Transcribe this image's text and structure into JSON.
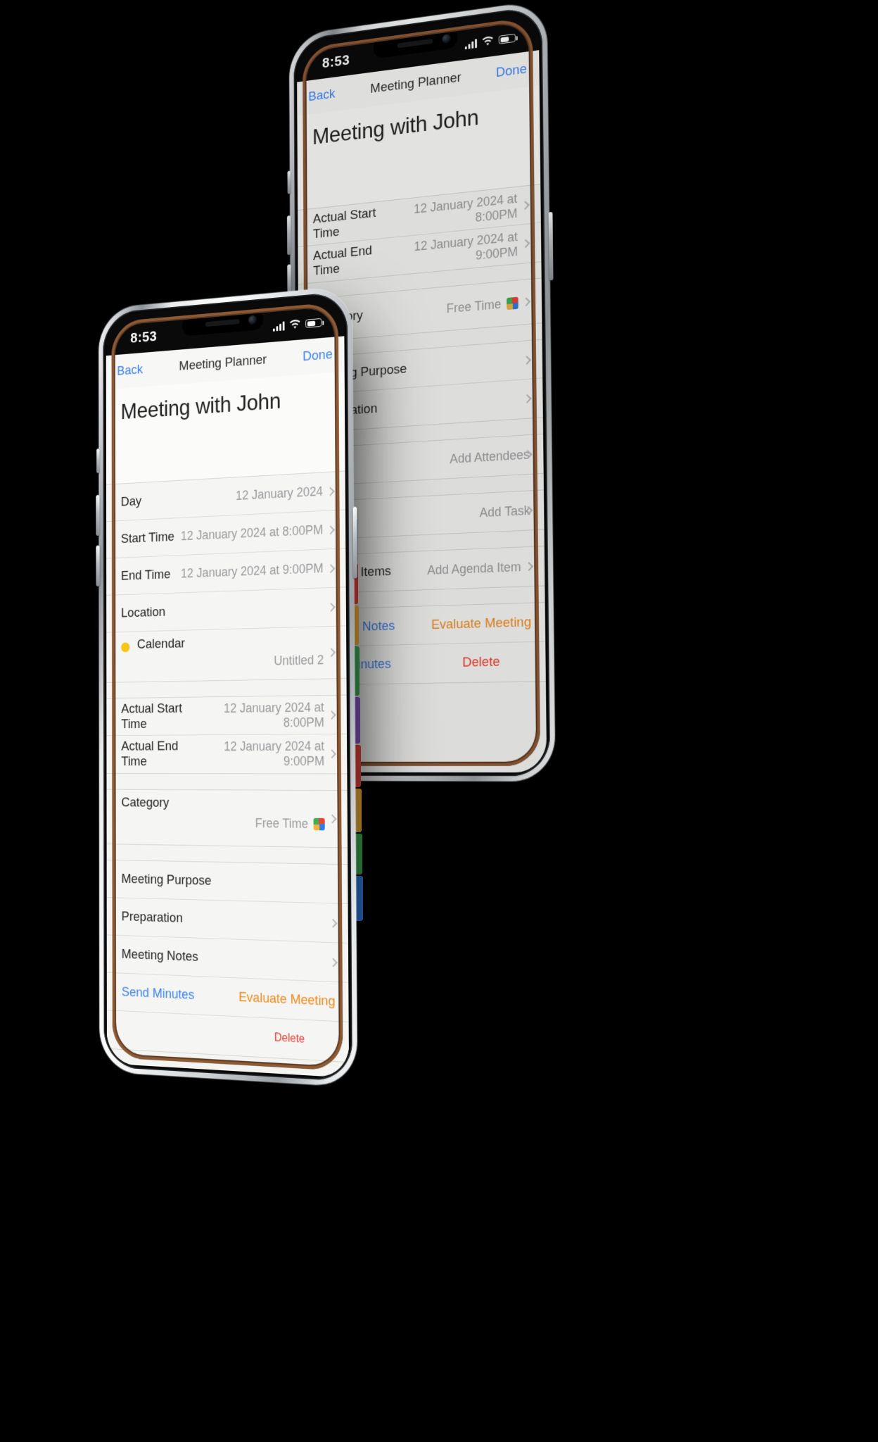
{
  "scene": {
    "background_color": "#000000",
    "device_count": 2
  },
  "status_bar": {
    "time": "8:53",
    "signal_icon": "cellular-bars-icon",
    "wifi_icon": "wifi-icon",
    "battery_icon": "battery-icon"
  },
  "navbar": {
    "back_label": "Back",
    "title": "Meeting Planner",
    "done_label": "Done"
  },
  "detail": {
    "meeting_title": "Meeting with John"
  },
  "colors": {
    "tint_blue": "#3b83f6",
    "tint_orange": "#f08b1d",
    "destructive_red": "#ef3b2d",
    "calendar_dot_yellow": "#f5c518",
    "value_gray": "#9a9a9e",
    "screen_background": "#f4f4f2"
  },
  "front_phone": {
    "groups": [
      {
        "rows": [
          {
            "label": "Day",
            "value": "12 January 2024",
            "chevron": true
          },
          {
            "label": "Start Time",
            "value": "12 January 2024 at 8:00PM",
            "chevron": true
          },
          {
            "label": "End Time",
            "value": "12 January 2024 at 9:00PM",
            "chevron": true
          },
          {
            "label": "Location",
            "value": "",
            "chevron": true
          },
          {
            "label": "Calendar",
            "value": "Untitled 2",
            "chevron": true,
            "dot": true
          }
        ]
      },
      {
        "rows": [
          {
            "label": "Actual Start Time",
            "value": "12 January 2024 at 8:00PM",
            "chevron": true
          },
          {
            "label": "Actual End Time",
            "value": "12 January 2024 at 9:00PM",
            "chevron": true
          }
        ]
      },
      {
        "rows": [
          {
            "label": "Category",
            "value": "Free Time",
            "chevron": true,
            "swatch": true
          }
        ]
      },
      {
        "rows": [
          {
            "label": "Meeting Purpose",
            "value": "",
            "chevron": false
          },
          {
            "label": "Preparation",
            "value": "",
            "chevron": true
          },
          {
            "label": "Meeting Notes",
            "value": "",
            "chevron": true,
            "link": "blue"
          }
        ]
      }
    ],
    "actions": {
      "send_minutes": "Send Minutes",
      "evaluate_meeting": "Evaluate Meeting",
      "delete": "Delete"
    }
  },
  "back_phone": {
    "rows": [
      {
        "label": "Actual Start Time",
        "value": "12 January 2024 at 8:00PM",
        "chevron": true
      },
      {
        "label": "Actual End Time",
        "value": "12 January 2024 at 9:00PM",
        "chevron": true
      },
      {
        "label": "Category",
        "value": "Free Time",
        "chevron": true,
        "swatch": true
      },
      {
        "label": "Meeting Purpose",
        "value": "",
        "chevron": true
      },
      {
        "label": "Preparation",
        "value": "",
        "chevron": true
      },
      {
        "label": "",
        "value": "Add Attendees",
        "chevron": true
      },
      {
        "label": "",
        "value": "Add Task",
        "chevron": true
      },
      {
        "label": "Agenda Items",
        "value": "Add Agenda Item",
        "chevron": true
      }
    ],
    "links": {
      "meeting_notes": "Meeting Notes",
      "send_minutes": "Send Minutes",
      "evaluate_meeting": "Evaluate Meeting",
      "delete": "Delete"
    }
  }
}
